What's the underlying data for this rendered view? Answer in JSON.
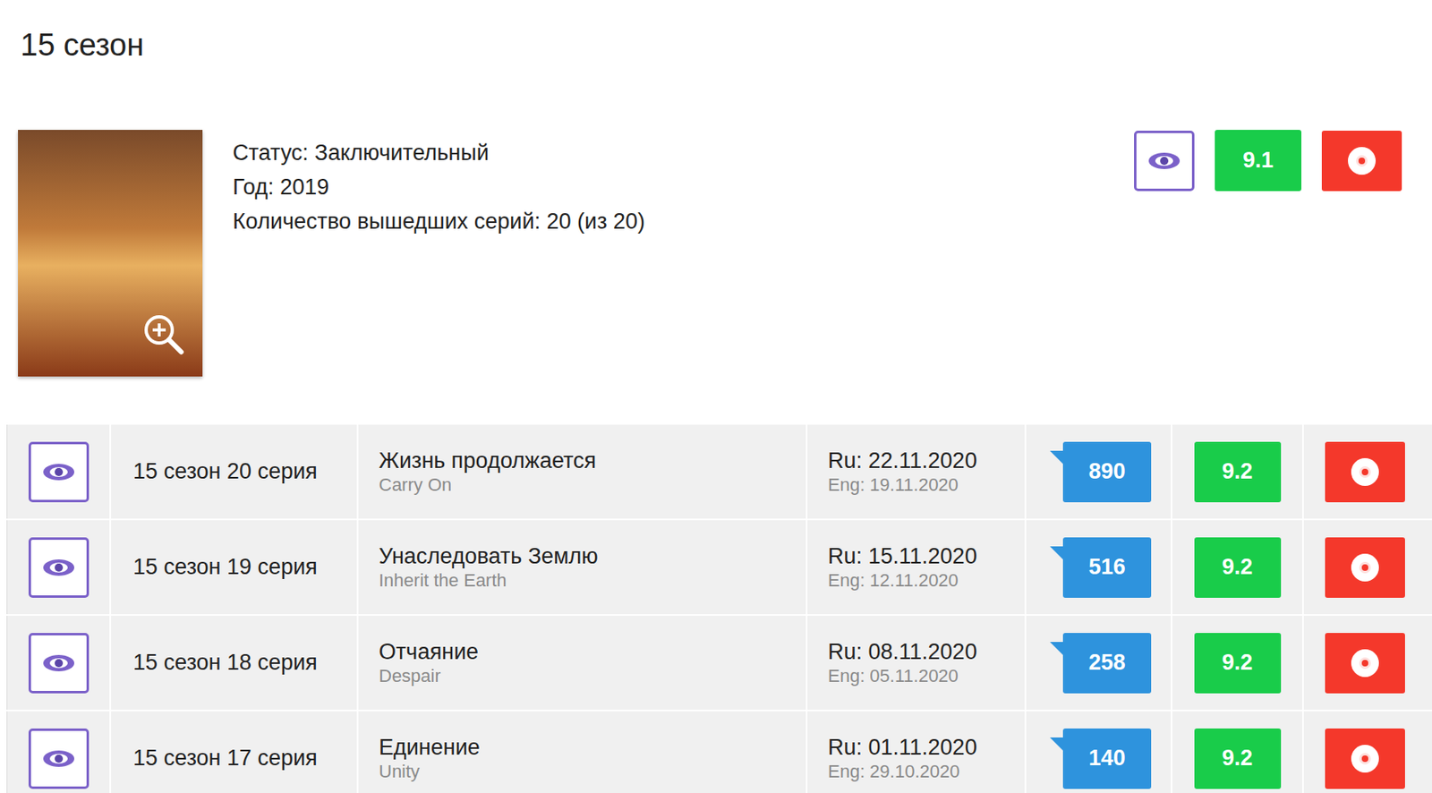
{
  "season": {
    "heading": "15 сезон",
    "info": [
      "Статус: Заключительный",
      "Год: 2019",
      "Количество вышедших серий: 20 (из 20)"
    ],
    "rating": "9.1",
    "watched": false
  },
  "episodes": [
    {
      "label": "15 сезон 20 серия",
      "title": "Жизнь продолжается",
      "title_en": "Carry On",
      "date_ru": "Ru: 22.11.2020",
      "date_en": "Eng: 19.11.2020",
      "comments": "890",
      "rating": "9.2",
      "watched": false
    },
    {
      "label": "15 сезон 19 серия",
      "title": "Унаследовать Землю",
      "title_en": "Inherit the Earth",
      "date_ru": "Ru: 15.11.2020",
      "date_en": "Eng: 12.11.2020",
      "comments": "516",
      "rating": "9.2",
      "watched": false
    },
    {
      "label": "15 сезон 18 серия",
      "title": "Отчаяние",
      "title_en": "Despair",
      "date_ru": "Ru: 08.11.2020",
      "date_en": "Eng: 05.11.2020",
      "comments": "258",
      "rating": "9.2",
      "watched": false
    },
    {
      "label": "15 сезон 17 серия",
      "title": "Единение",
      "title_en": "Unity",
      "date_ru": "Ru: 01.11.2020",
      "date_en": "Eng: 29.10.2020",
      "comments": "140",
      "rating": "9.2",
      "watched": false
    }
  ]
}
